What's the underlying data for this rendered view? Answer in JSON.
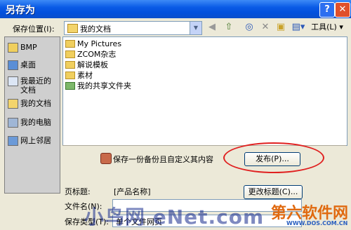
{
  "window": {
    "title": "另存为",
    "help_glyph": "?",
    "close_glyph": "✕"
  },
  "toolbar": {
    "save_in_label": "保存位置(I):",
    "save_in_value": "我的文档",
    "back_icon": "back-icon",
    "tools_label": "工具(L)",
    "dropdown_glyph": "▼"
  },
  "sidebar": {
    "items": [
      {
        "label": "BMP",
        "icon": "folder-icon"
      },
      {
        "label": "桌面",
        "icon": "desktop-icon"
      },
      {
        "label": "我最近的文档",
        "icon": "recent-documents-icon"
      },
      {
        "label": "我的文档",
        "icon": "my-documents-icon"
      },
      {
        "label": "我的电脑",
        "icon": "my-computer-icon"
      },
      {
        "label": "网上邻居",
        "icon": "network-places-icon"
      }
    ]
  },
  "files": [
    {
      "name": "My Pictures",
      "icon": "folder-icon"
    },
    {
      "name": "ZCOM杂志",
      "icon": "folder-icon"
    },
    {
      "name": "解说模板",
      "icon": "folder-icon"
    },
    {
      "name": "素材",
      "icon": "folder-icon"
    },
    {
      "name": "我的共享文件夹",
      "icon": "shared-folder-icon"
    }
  ],
  "publish": {
    "text": "保存一份备份且自定义其内容",
    "button_label": "发布(P)..."
  },
  "page_title": {
    "label": "页标题:",
    "value": "[产品名称]",
    "change_button": "更改标题(C)..."
  },
  "file_name": {
    "label": "文件名(N):"
  },
  "save_type": {
    "label": "保存类型(T):",
    "value": "单个文件网页"
  },
  "watermark": {
    "left_text": "小鸟网 eNet.com",
    "right_text": "第六软件网",
    "right_url": "WWW.DOS.COM.CN"
  }
}
